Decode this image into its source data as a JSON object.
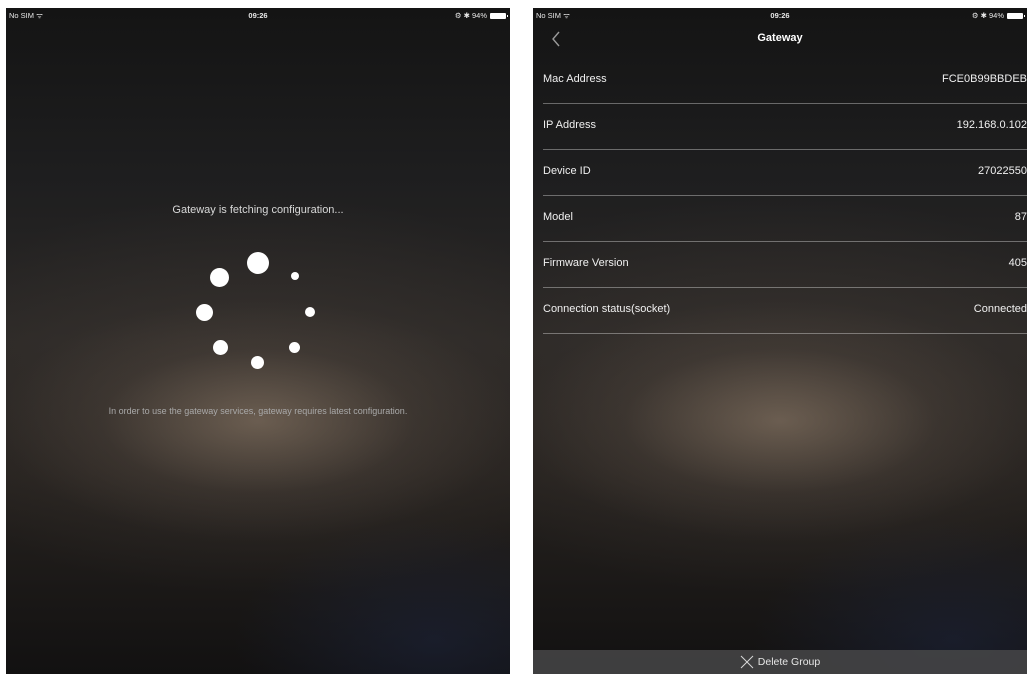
{
  "left_screen": {
    "status": {
      "carrier": "No SIM ᯤ",
      "time": "09:26",
      "battery": "⚙ ✱ 94%"
    },
    "fetching_title": "Gateway is fetching configuration...",
    "description": "In order to use the gateway services, gateway requires latest configuration."
  },
  "right_screen": {
    "status": {
      "carrier": "No SIM ᯤ",
      "time": "09:26",
      "battery": "⚙ ✱ 94%"
    },
    "nav": {
      "title": "Gateway"
    },
    "rows": [
      {
        "label": "Mac Address",
        "value": "FCE0B99BBDEB"
      },
      {
        "label": "IP Address",
        "value": "192.168.0.102"
      },
      {
        "label": "Device ID",
        "value": "27022550"
      },
      {
        "label": "Model",
        "value": "87"
      },
      {
        "label": "Firmware Version",
        "value": "405"
      },
      {
        "label": "Connection status(socket)",
        "value": "Connected"
      }
    ],
    "bottom": {
      "label": "Delete Group"
    }
  },
  "icons": {
    "back": "chevron-left-icon",
    "delete": "close-icon",
    "spinner": "loading-spinner-icon"
  },
  "colors": {
    "background": "#1e1e1f",
    "text": "#ffffff",
    "separator": "rgba(255,255,255,0.35)"
  }
}
